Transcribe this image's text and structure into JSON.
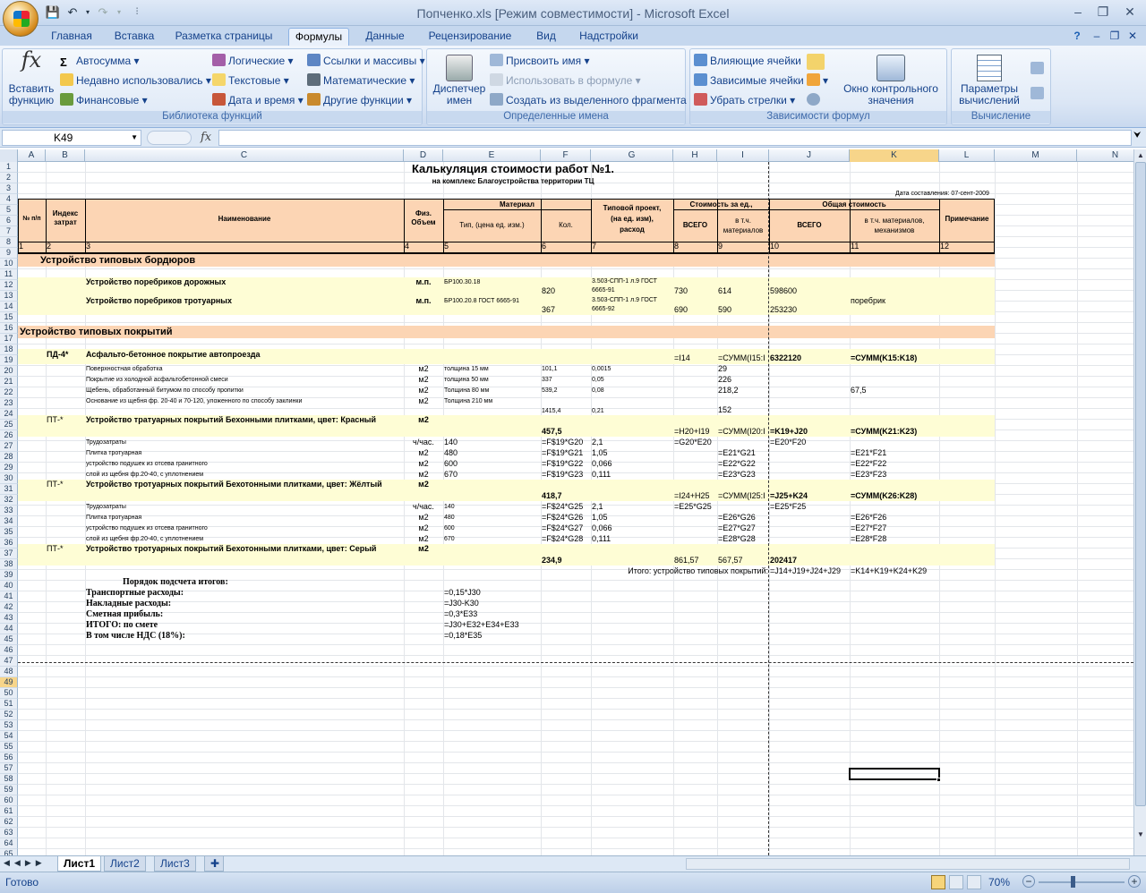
{
  "window": {
    "title": "Попченко.xls  [Режим совместимости] - Microsoft Excel"
  },
  "tabs": [
    "Главная",
    "Вставка",
    "Разметка страницы",
    "Формулы",
    "Данные",
    "Рецензирование",
    "Вид",
    "Надстройки"
  ],
  "ribbon": {
    "insert_function": "Вставить\nфункцию",
    "library": {
      "autosum": "Автосумма",
      "recent": "Недавно использовались",
      "financial": "Финансовые",
      "logical": "Логические",
      "text": "Текстовые",
      "datetime": "Дата и время",
      "lookup": "Ссылки и массивы",
      "math": "Математические",
      "other": "Другие функции",
      "label": "Библиотека функций"
    },
    "names": {
      "manager": "Диспетчер\nимен",
      "assign": "Присвоить имя",
      "use": "Использовать в формуле",
      "create": "Создать из выделенного фрагмента",
      "label": "Определенные имена"
    },
    "audit": {
      "precedents": "Влияющие ячейки",
      "dependents": "Зависимые ячейки",
      "remove": "Убрать стрелки",
      "watch": "Окно контрольного\nзначения",
      "label": "Зависимости формул"
    },
    "calc": {
      "options": "Параметры\nвычислений",
      "label": "Вычисление"
    }
  },
  "namebox": "K49",
  "columns": [
    "A",
    "B",
    "C",
    "D",
    "E",
    "F",
    "G",
    "H",
    "I",
    "J",
    "K",
    "L",
    "M",
    "N"
  ],
  "cells": {
    "title": "Калькуляция стоимости работ №1.",
    "subtitle": "на комплекс Благоустройства территории ТЦ",
    "date": "Дата составления: 07-сент-2009",
    "h_num": "№ п/п",
    "h_idx": "Индекс\nзатрат",
    "h_name": "Наименование",
    "h_vol": "Физ.\nОбъем",
    "h_mat": "Материал",
    "h_type": "Тип, (цена ед. изм.)",
    "h_qty": "Кол.",
    "h_proj": "Типовой проект,\n(на ед. изм),\nрасход",
    "h_unit": "Стоимость за ед.,",
    "h_all1": "ВСЕГО",
    "h_incl1": "в т.ч.\nматериалов",
    "h_total": "Общая стоимость",
    "h_all2": "ВСЕГО",
    "h_incl2": "в т.ч. материалов,\nмеханизмов",
    "h_note": "Примечание",
    "n1": "1",
    "n2": "2",
    "n3": "3",
    "n4": "4",
    "n5": "5",
    "n6": "6",
    "n7": "7",
    "n8": "8",
    "n9": "9",
    "n10": "10",
    "n11": "11",
    "n12": "12",
    "s7": "Устройство типовых бордюров",
    "r9c": "Устройство поребриков дорожных",
    "r9d": "м.п.",
    "r9e": "БР100.30.18",
    "r9f": "820",
    "r9g": "3.503-СПП-1 л.9 ГОСТ\n6665-91",
    "r9h": "730",
    "r9i": "614",
    "r9j": "598600",
    "r10c": "Устройство поребриков тротуарных",
    "r10d": "м.п.",
    "r10e": "БР100.20.8 ГОСТ 6665-91",
    "r10f": "367",
    "r10g": "3.503-СПП-1 л.9 ГОСТ\n6665-92",
    "r10h": "690",
    "r10i": "590",
    "r10j": "253230",
    "r10k": "поребрик",
    "s12": "Устройство типовых покрытий",
    "r14b": "ПД-4*",
    "r14c": "Асфальто-бетонное покрытие автопроезда",
    "r14h": "=I14",
    "r14i": "=СУММ(I15:I",
    "r14j": "6322120",
    "r14k": "=СУММ(K15:K18)",
    "r15c": "Поверхностная обработка",
    "r15d": "м2",
    "r15e": "толщина 15 мм",
    "r15f": "101,1",
    "r15g": "0,0015",
    "r15i": "29",
    "r16c": "Покрытие из холодной асфальтобетонной смеси",
    "r16d": "м2",
    "r16e": "толщина 50 мм",
    "r16f": "337",
    "r16g": "0,05",
    "r16i": "226",
    "r17c": "Щебень, обработанный битумом по способу пропитки",
    "r17d": "м2",
    "r17e": "Толщина 80 мм",
    "r17f": "539,2",
    "r17g": "0,08",
    "r17i": "218,2",
    "r17k": "67,5",
    "r18c": "Основание из щебня фр. 20-40 и 70-120, уложенного по способу заклинки",
    "r18d": "м2",
    "r18e": "Толщина 210 мм",
    "r18f": "1415,4",
    "r18g": "0,21",
    "r18i": "152",
    "r19b": "ПТ-*",
    "r19c": "Устройство тратуарных покрытий Бехонными плитками, цвет: Красный",
    "r19d": "м2",
    "r19f": "457,5",
    "r19h": "=H20+I19",
    "r19i": "=СУММ(I20:I",
    "r19j": "=K19+J20",
    "r19k": "=СУММ(K21:K23)",
    "r20c": "Трудозатраты",
    "r20d": "ч/час.",
    "r20e": "140",
    "r20f": "=F$19*G20",
    "r20g": "2,1",
    "r20h": "=G20*E20",
    "r20j": "=E20*F20",
    "r21c": "Плитка тротуарная",
    "r21d": "м2",
    "r21e": "480",
    "r21f": "=F$19*G21",
    "r21g": "1,05",
    "r21i": "=E21*G21",
    "r21k": "=E21*F21",
    "r22c": "устройство подушек из отсева гранитного",
    "r22d": "м2",
    "r22e": "600",
    "r22f": "=F$19*G22",
    "r22g": "0,066",
    "r22i": "=E22*G22",
    "r22k": "=E22*F22",
    "r23c": "слой из щебня фр.20-40, с уплотнением",
    "r23d": "м2",
    "r23e": "670",
    "r23f": "=F$19*G23",
    "r23g": "0,111",
    "r23i": "=E23*G23",
    "r23k": "=E23*F23",
    "r24b": "ПТ-*",
    "r24c": "Устройство тротуарных покрытий Бехотонными плитками, цвет: Жёлтый",
    "r24d": "м2",
    "r24f": "418,7",
    "r24h": "=I24+H25",
    "r24i": "=СУММ(I25:I",
    "r24j": "=J25+K24",
    "r24k": "=СУММ(K26:K28)",
    "r25c": "Трудозатраты",
    "r25d": "ч/час.",
    "r25e": "140",
    "r25f": "=F$24*G25",
    "r25g": "2,1",
    "r25h": "=E25*G25",
    "r25j": "=E25*F25",
    "r26c": "Плитка тротуарная",
    "r26d": "м2",
    "r26e": "480",
    "r26f": "=F$24*G26",
    "r26g": "1,05",
    "r26i": "=E26*G26",
    "r26k": "=E26*F26",
    "r27c": "устройство подушек из отсева гранитного",
    "r27d": "м2",
    "r27e": "600",
    "r27f": "=F$24*G27",
    "r27g": "0,066",
    "r27i": "=E27*G27",
    "r27k": "=E27*F27",
    "r28c": "слой из щебня фр.20-40, с уплотнением",
    "r28d": "м2",
    "r28e": "670",
    "r28f": "=F$24*G28",
    "r28g": "0,111",
    "r28i": "=E28*G28",
    "r28k": "=E28*F28",
    "r29b": "ПТ-*",
    "r29c": "Устройство тротуарных покрытий Бехотонными плитками, цвет: Серый",
    "r29d": "м2",
    "r29f": "234,9",
    "r29h": "861,57",
    "r29i": "567,57",
    "r29j": "202417",
    "r30g": "Итого: устройство типовых покрытий:",
    "r30j": "=J14+J19+J24+J29",
    "r30k": "=K14+K19+K24+K29",
    "r31": "Порядок подсчета итогов:",
    "r32c": "Транспортные расходы:",
    "r32e": "=0,15*J30",
    "r33c": "Накладные расходы:",
    "r33e": "=J30-K30",
    "r34c": "Сметная прибыль:",
    "r34e": "=0,3*E33",
    "r35c": "ИТОГО: по смете",
    "r35e": "=J30+E32+E34+E33",
    "r36c": "В том числе НДС (18%):",
    "r36e": "=0,18*E35"
  },
  "sheets": [
    "Лист1",
    "Лист2",
    "Лист3"
  ],
  "status": {
    "ready": "Готово",
    "zoom": "70%"
  }
}
